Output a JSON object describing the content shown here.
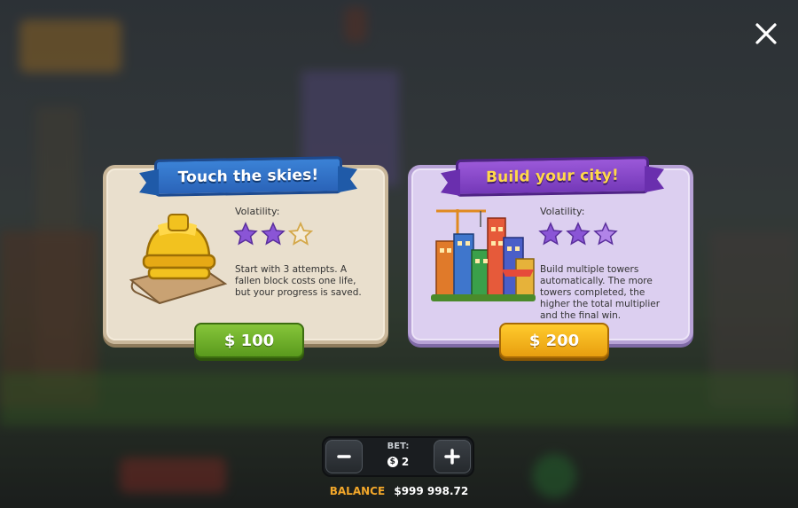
{
  "close_button": {
    "icon": "close-icon"
  },
  "modes": [
    {
      "title": "Touch the skies!",
      "volatility_label": "Volatility:",
      "volatility_level": 2,
      "volatility_max": 3,
      "description": "Start with 3 attempts. A fallen block costs one life, but your progress is saved.",
      "price": "$ 100",
      "illustration": "hard-hat-blueprint-icon",
      "accent": "#2f6cc4"
    },
    {
      "title": "Build your city!",
      "volatility_label": "Volatility:",
      "volatility_level": 3,
      "volatility_max": 3,
      "description": "Build multiple towers automatically. The more towers completed, the higher the total multiplier and the final win.",
      "price": "$ 200",
      "illustration": "city-towers-crane-icon",
      "accent": "#8a48c8"
    }
  ],
  "bet": {
    "label": "BET:",
    "value": "2",
    "currency_icon": "dollar-coin-icon"
  },
  "balance": {
    "label": "BALANCE",
    "value": "$999 998.72"
  }
}
